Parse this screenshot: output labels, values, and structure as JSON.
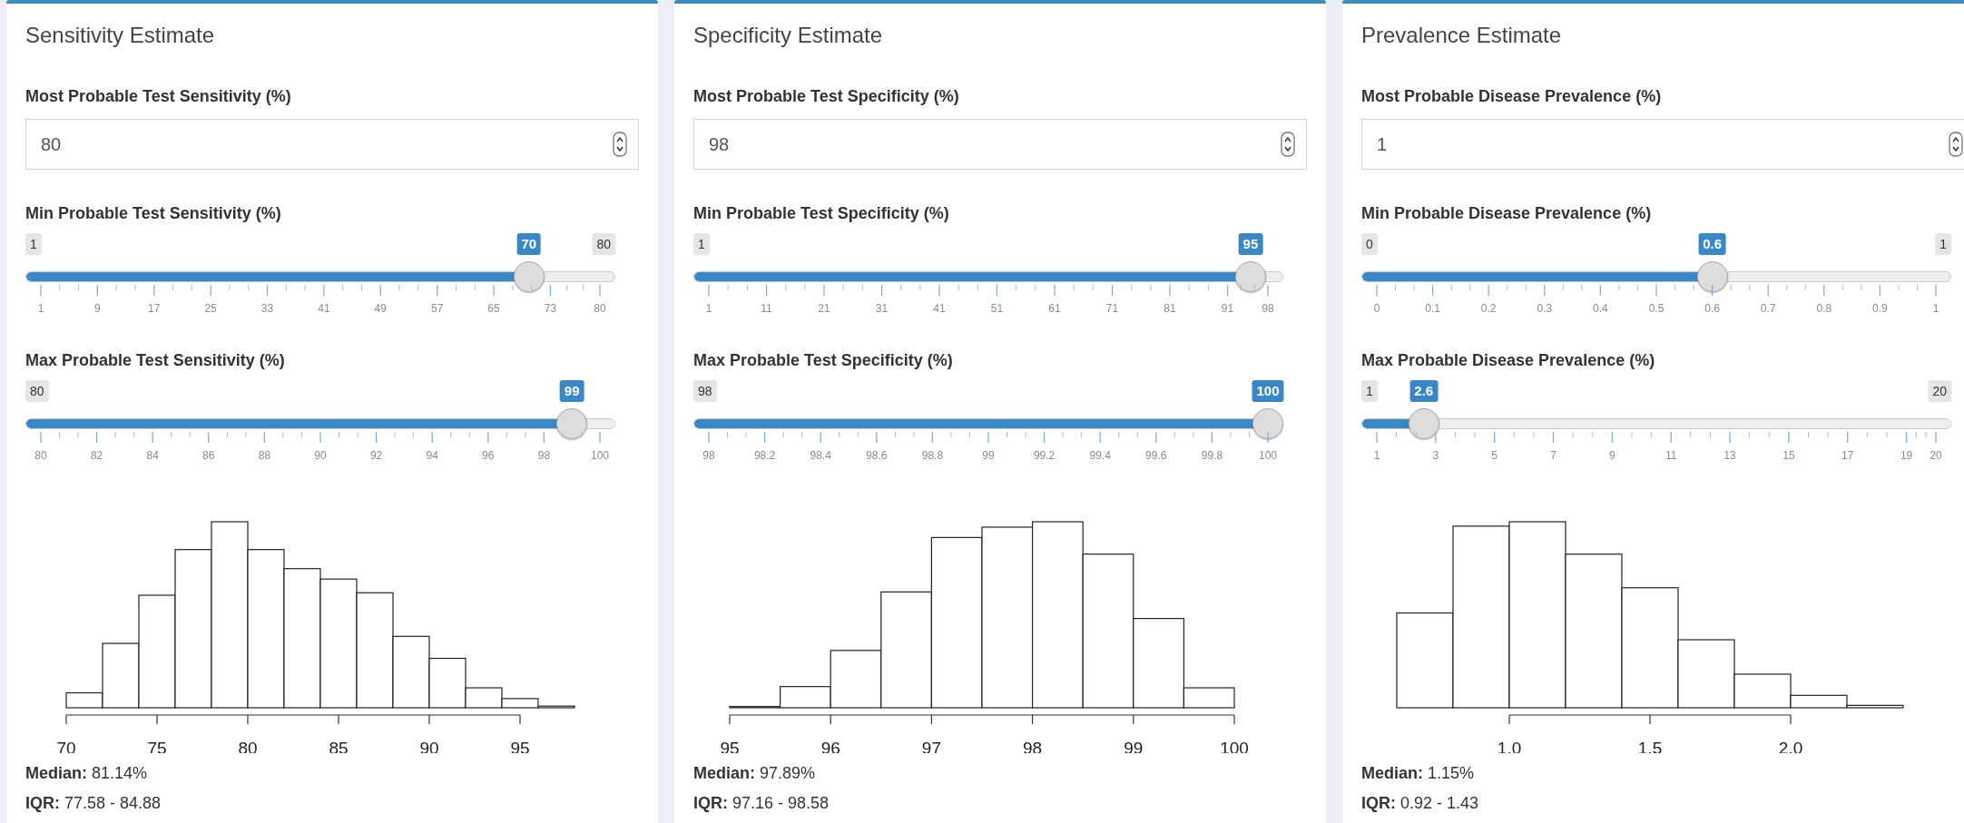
{
  "panels": [
    {
      "title": "Sensitivity Estimate",
      "input": {
        "label": "Most Probable Test Sensitivity (%)",
        "value": "80"
      },
      "sliders": [
        {
          "label": "Min Probable Test Sensitivity (%)",
          "min_label": "1",
          "max_label": "80",
          "value_label": "70",
          "level": 0.873,
          "ticks": [
            "1",
            "9",
            "17",
            "25",
            "33",
            "41",
            "49",
            "57",
            "65",
            "73",
            "80"
          ]
        },
        {
          "label": "Max Probable Test Sensitivity (%)",
          "min_label": "80",
          "value_label": "99",
          "level": 0.95,
          "ticks": [
            "80",
            "82",
            "84",
            "86",
            "88",
            "90",
            "92",
            "94",
            "96",
            "98",
            "100"
          ]
        }
      ],
      "histogram": {
        "axis_labels": [
          "70",
          "75",
          "80",
          "85",
          "90",
          "95"
        ]
      },
      "summary": [
        "**Median:** 81.14%",
        "**IQR:** 77.58 - 84.88"
      ]
    },
    {
      "title": "Specificity Estimate",
      "input": {
        "label": "Most Probable Test Specificity (%)",
        "value": "98"
      },
      "sliders": [
        {
          "label": "Min Probable Test Specificity (%)",
          "min_label": "1",
          "value_label": "95",
          "level": 0.969,
          "ticks": [
            "1",
            "11",
            "21",
            "31",
            "41",
            "51",
            "61",
            "71",
            "81",
            "91",
            "98"
          ]
        },
        {
          "label": "Max Probable Test Specificity (%)",
          "min_label": "98",
          "value_label": "100",
          "level": 1.0,
          "ticks": [
            "98",
            "98.2",
            "98.4",
            "98.6",
            "98.8",
            "99",
            "99.2",
            "99.4",
            "99.6",
            "99.8",
            "100"
          ]
        }
      ],
      "histogram": {
        "axis_labels": [
          "95",
          "96",
          "97",
          "98",
          "99",
          "100"
        ]
      },
      "summary": [
        "**Median:** 97.89%",
        "**IQR:** 97.16 - 98.58"
      ]
    },
    {
      "title": "Prevalence Estimate",
      "input": {
        "label": "Most Probable Disease Prevalence (%)",
        "value": "1"
      },
      "sliders": [
        {
          "label": "Min Probable Disease Prevalence (%)",
          "min_label": "0",
          "max_label": "1",
          "value_label": "0.6",
          "level": 0.6,
          "ticks": [
            "0",
            "0.1",
            "0.2",
            "0.3",
            "0.4",
            "0.5",
            "0.6",
            "0.7",
            "0.8",
            "0.9",
            "1"
          ]
        },
        {
          "label": "Max Probable Disease Prevalence (%)",
          "min_label": "1",
          "max_label": "20",
          "value_label": "2.6",
          "level": 0.084,
          "ticks": [
            "1",
            "3",
            "5",
            "7",
            "9",
            "11",
            "13",
            "15",
            "17",
            "19",
            "20"
          ]
        }
      ],
      "histogram": {
        "axis_labels": [
          "1.0",
          "1.5",
          "2.0"
        ]
      },
      "summary": [
        "**Median:** 1.15%",
        "**IQR:** 0.92 - 1.43"
      ]
    }
  ]
}
